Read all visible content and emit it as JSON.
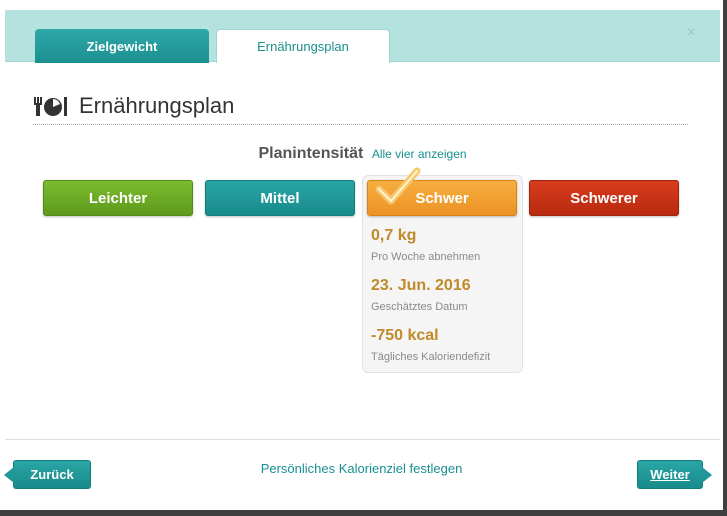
{
  "tabs": [
    {
      "label": "Zielgewicht",
      "active": false
    },
    {
      "label": "Ernährungsplan",
      "active": true
    }
  ],
  "close": {
    "glyph": "×"
  },
  "heading": {
    "icon": "cutlery-plate-icon",
    "title": "Ernährungsplan"
  },
  "intensity": {
    "label": "Planintensität",
    "link": "Alle vier anzeigen"
  },
  "levels": [
    {
      "label": "Leichter",
      "color": "#6aa923"
    },
    {
      "label": "Mittel",
      "color": "#1f9799"
    },
    {
      "label": "Schwer",
      "color": "#f0a030",
      "selected": true
    },
    {
      "label": "Schwerer",
      "color": "#c3321a"
    }
  ],
  "stats": [
    {
      "value": "0,7 kg",
      "label": "Pro Woche abnehmen"
    },
    {
      "value": "23. Jun. 2016",
      "label": "Geschätztes Datum"
    },
    {
      "value": "-750 kcal",
      "label": "Tägliches Kaloriendefizit"
    }
  ],
  "footer": {
    "back": "Zurück",
    "link": "Persönliches Kalorienziel festlegen",
    "next": "Weiter"
  }
}
